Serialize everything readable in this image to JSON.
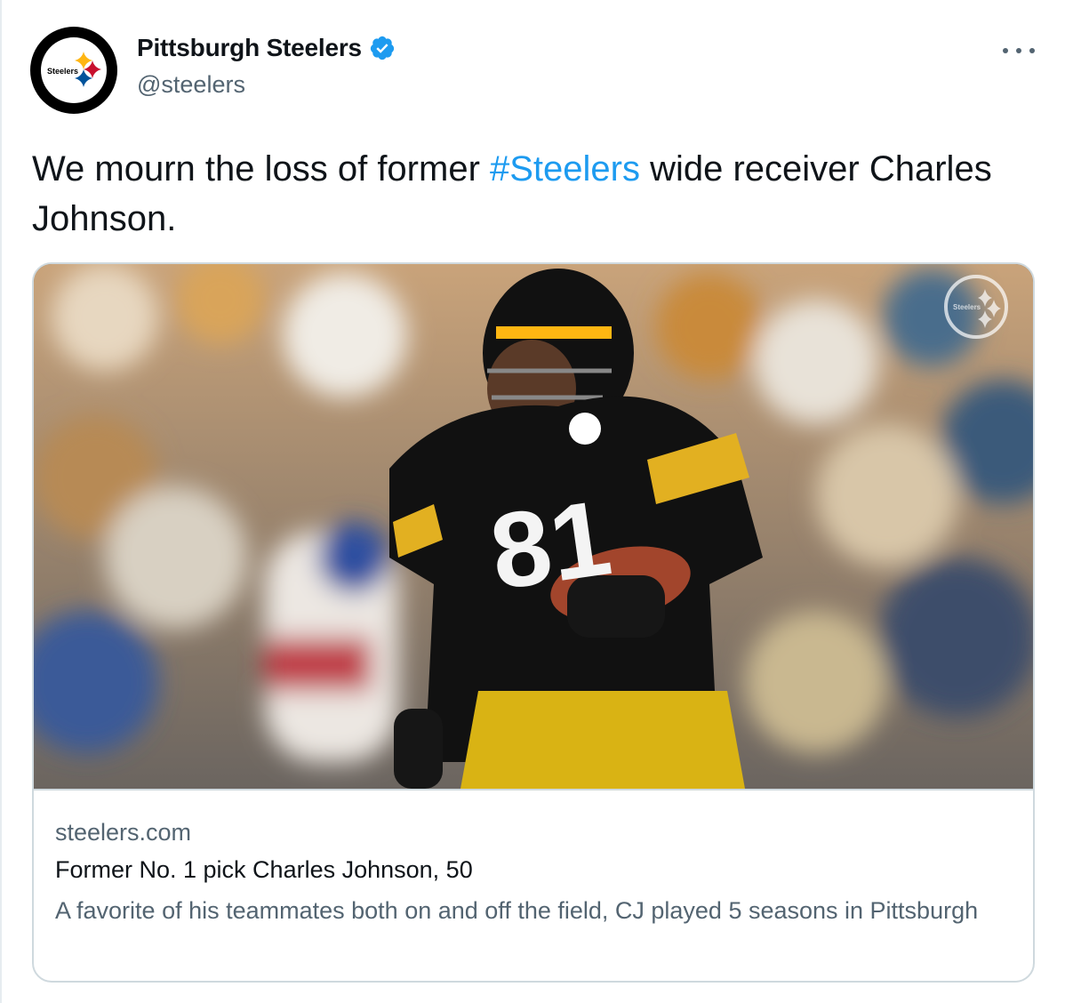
{
  "account": {
    "display_name": "Pittsburgh Steelers",
    "handle": "@steelers",
    "verified": true,
    "avatar_text": "Steelers"
  },
  "tweet": {
    "text_before": "We mourn the loss of former ",
    "hashtag": "#Steelers",
    "text_after": " wide receiver Charles Johnson."
  },
  "card": {
    "image_icon": "football-player-photo",
    "jersey_number": "81",
    "watermark_text": "Steelers",
    "domain": "steelers.com",
    "title": "Former No. 1 pick Charles Johnson, 50",
    "description": "A favorite of his teammates both on and off the field, CJ played 5 seasons in Pittsburgh"
  },
  "colors": {
    "link": "#1d9bf0",
    "verified": "#1d9bf0",
    "secondary_text": "#536471",
    "border": "#cfd9de",
    "steelers_gold": "#ffb612",
    "steelers_red": "#c8102e",
    "steelers_blue": "#00539b"
  }
}
